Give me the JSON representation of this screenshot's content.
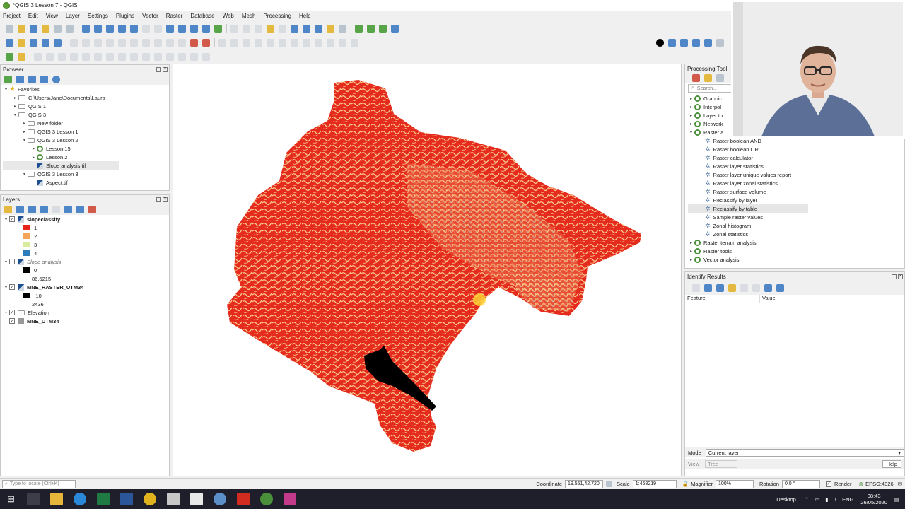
{
  "window": {
    "title": "*QGIS 3 Lesson 7 - QGIS"
  },
  "menu": [
    "Project",
    "Edit",
    "View",
    "Layer",
    "Settings",
    "Plugins",
    "Vector",
    "Raster",
    "Database",
    "Web",
    "Mesh",
    "Processing",
    "Help"
  ],
  "browser": {
    "title": "Browser",
    "items": [
      {
        "label": "Favorites",
        "indent": 0,
        "expanded": true,
        "type": "favorites"
      },
      {
        "label": "C:\\Users\\Jane\\Documents\\Laura",
        "indent": 1,
        "expanded": false,
        "type": "folder"
      },
      {
        "label": "QGIS 1",
        "indent": 1,
        "expanded": false,
        "type": "folder"
      },
      {
        "label": "QGIS 3",
        "indent": 1,
        "expanded": true,
        "type": "folder"
      },
      {
        "label": "New folder",
        "indent": 2,
        "expanded": false,
        "type": "folder"
      },
      {
        "label": "QGIS 3 Lesson 1",
        "indent": 2,
        "expanded": false,
        "type": "folder"
      },
      {
        "label": "QGIS 3 Lesson 2",
        "indent": 2,
        "expanded": true,
        "type": "folder"
      },
      {
        "label": "Lesson 15",
        "indent": 3,
        "expanded": false,
        "type": "qgis"
      },
      {
        "label": "Lesson 2",
        "indent": 3,
        "expanded": false,
        "type": "qgis"
      },
      {
        "label": "Slope analysis.tif",
        "indent": 3,
        "expanded": null,
        "type": "raster",
        "selected": true
      },
      {
        "label": "QGIS 3 Lesson 3",
        "indent": 2,
        "expanded": true,
        "type": "folder"
      },
      {
        "label": "Aspect.tif",
        "indent": 3,
        "expanded": null,
        "type": "raster"
      }
    ]
  },
  "layers": {
    "title": "Layers",
    "items": [
      {
        "kind": "layer",
        "label": "slopeclassify",
        "checked": true,
        "bold": true,
        "italic": false
      },
      {
        "kind": "legend",
        "label": "1",
        "color": "#e8241a"
      },
      {
        "kind": "legend",
        "label": "2",
        "color": "#f6a45a"
      },
      {
        "kind": "legend",
        "label": "3",
        "color": "#d9ec9e"
      },
      {
        "kind": "legend",
        "label": "4",
        "color": "#2f7cba"
      },
      {
        "kind": "layer",
        "label": "Slope analysis",
        "checked": false,
        "bold": false,
        "italic": true
      },
      {
        "kind": "legend",
        "label": "0",
        "color": "#000000"
      },
      {
        "kind": "legendtext",
        "label": "86.6215"
      },
      {
        "kind": "layer",
        "label": "MNE_RASTER_UTM34",
        "checked": true,
        "bold": true,
        "italic": false
      },
      {
        "kind": "legend",
        "label": "-10",
        "color": "#000000"
      },
      {
        "kind": "legendtext",
        "label": "2436"
      },
      {
        "kind": "layer",
        "label": "Elevation",
        "checked": true,
        "bold": false,
        "italic": false,
        "group": true
      },
      {
        "kind": "layer",
        "label": "MNE_UTM34",
        "checked": true,
        "bold": true,
        "italic": false,
        "vector": true
      }
    ]
  },
  "processing": {
    "title": "Processing Tool",
    "search_placeholder": "Search...",
    "groups_top": [
      "Graphic",
      "Interpol",
      "Layer to",
      "Network",
      "Raster a"
    ],
    "raster_analysis_items": [
      "Raster boolean AND",
      "Raster boolean OR",
      "Raster calculator",
      "Raster layer statistics",
      "Raster layer unique values report",
      "Raster layer zonal statistics",
      "Raster surface volume",
      "Reclassify by layer",
      "Reclassify by table",
      "Sample raster values",
      "Zonal histogram",
      "Zonal statistics"
    ],
    "selected_item": "Reclassify by table",
    "groups_bottom": [
      "Raster terrain analysis",
      "Raster tools",
      "Vector analysis"
    ]
  },
  "identify": {
    "title": "Identify Results",
    "columns": [
      "Feature",
      "Value"
    ],
    "mode_label": "Mode",
    "mode_value": "Current layer",
    "view_label": "View",
    "view_value": "Tree",
    "help_label": "Help"
  },
  "statusbar": {
    "locate_placeholder": "Type to locate (Ctrl+K)",
    "coordinate_label": "Coordinate",
    "coordinate_value": "19.551,42.720",
    "scale_label": "Scale",
    "scale_value": "1:468219",
    "magnifier_label": "Magnifier",
    "magnifier_value": "100%",
    "rotation_label": "Rotation",
    "rotation_value": "0.0 °",
    "render_label": "Render",
    "crs": "EPSG:4326"
  },
  "taskbar": {
    "desktop_label": "Desktop",
    "language": "ENG",
    "time": "08:43",
    "date": "26/05/2020"
  },
  "colors": {
    "slope_low": "#e52b1e",
    "slope_mid": "#f7c98a",
    "water": "#2f7cba",
    "black_area": "#000000"
  }
}
